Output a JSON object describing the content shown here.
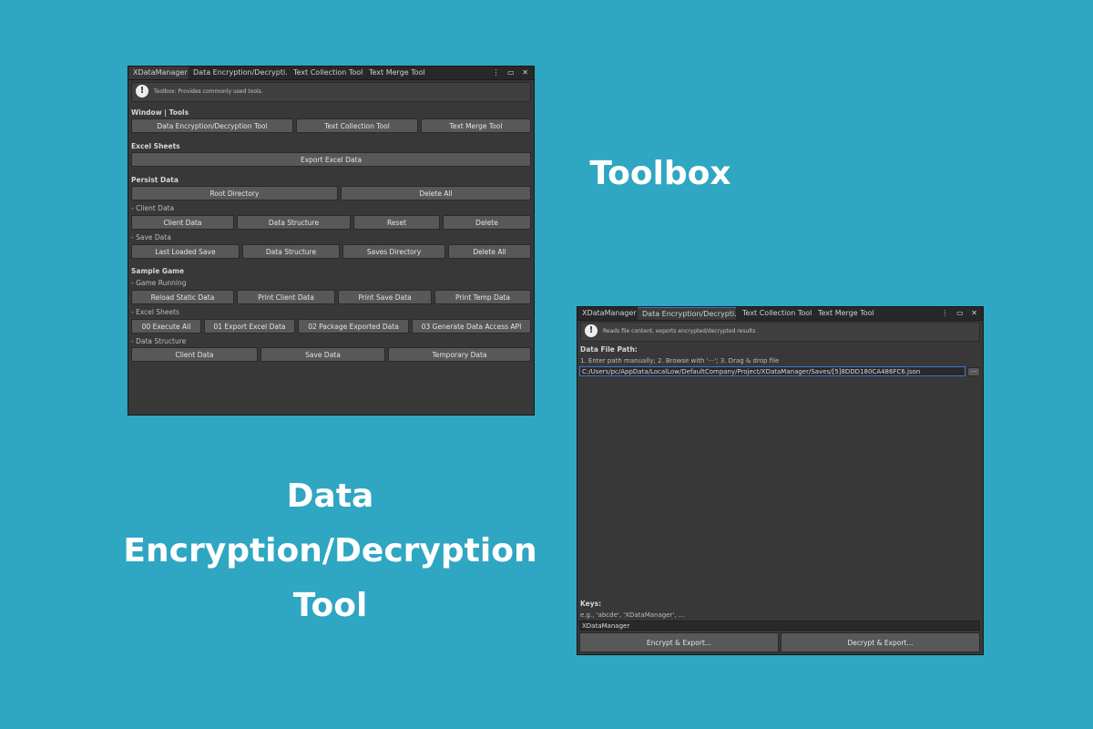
{
  "captions": {
    "toolbox": "Toolbox",
    "encryption_tool": "Data\nEncryption/Decryption\nTool"
  },
  "window1": {
    "tabs": [
      "XDataManager",
      "Data Encryption/Decrypti...",
      "Text Collection Tool",
      "Text Merge Tool"
    ],
    "controls": "⋮ ▭ ✕",
    "info_icon": "exclamation-icon",
    "info_text": "Toolbox: Provides commonly used tools.",
    "sections": {
      "window_tools": {
        "label": "Window | Tools",
        "buttons": [
          "Data Encryption/Decryption Tool",
          "Text Collection Tool",
          "Text Merge Tool"
        ]
      },
      "excel_sheets": {
        "label": "Excel Sheets",
        "buttons": [
          "Export Excel Data"
        ]
      },
      "persist_data": {
        "label": "Persist Data",
        "buttons": [
          "Root Directory",
          "Delete All"
        ],
        "client_data": {
          "label": "- Client Data",
          "buttons": [
            "Client Data",
            "Data Structure",
            "Reset",
            "Delete"
          ]
        },
        "save_data": {
          "label": "- Save Data",
          "buttons": [
            "Last Loaded Save",
            "Data Structure",
            "Saves Directory",
            "Delete All"
          ]
        }
      },
      "sample_game": {
        "label": "Sample Game",
        "game_running": {
          "label": "- Game Running",
          "buttons": [
            "Reload Static Data",
            "Print Client Data",
            "Print Save Data",
            "Print Temp Data"
          ]
        },
        "excel_sheets": {
          "label": "- Excel Sheets",
          "buttons": [
            "00 Execute All",
            "01 Export Excel Data",
            "02 Package Exported Data",
            "03 Generate Data Access API"
          ]
        },
        "data_structure": {
          "label": "- Data Structure",
          "buttons": [
            "Client Data",
            "Save Data",
            "Temporary Data"
          ]
        }
      }
    }
  },
  "window2": {
    "tabs": [
      "XDataManager",
      "Data Encryption/Decrypti...",
      "Text Collection Tool",
      "Text Merge Tool"
    ],
    "controls": "⋮ ▭ ✕",
    "info_icon": "exclamation-icon",
    "info_text": "Reads file content, exports encrypted/decrypted results",
    "file_path": {
      "label": "Data File Path:",
      "hint": "1. Enter path manually; 2. Browse with '···'; 3. Drag & drop file",
      "value": "C:/Users/pc/AppData/LocalLow/DefaultCompany/Project/XDataManager/Saves/[5]8DDD180CA486FC6.json",
      "browse_label": "···"
    },
    "keys": {
      "label": "Keys:",
      "hint": "e.g., 'abcde', 'XDataManager', ...",
      "value": "XDataManager"
    },
    "encrypt_label": "Encrypt & Export...",
    "decrypt_label": "Decrypt & Export..."
  }
}
